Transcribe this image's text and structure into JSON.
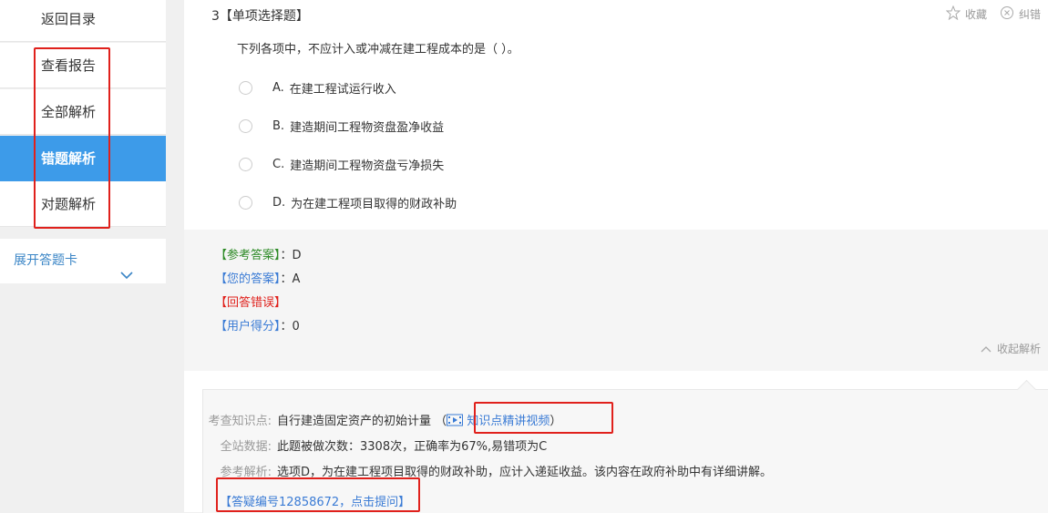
{
  "sidebar": {
    "items": [
      {
        "label": "返回目录"
      },
      {
        "label": "查看报告"
      },
      {
        "label": "全部解析"
      },
      {
        "label": "错题解析"
      },
      {
        "label": "对题解析"
      }
    ],
    "expand_label": "展开答题卡",
    "active_color": "#3d9be9"
  },
  "question": {
    "title": "3【单项选择题】",
    "favorite_label": "收藏",
    "report_label": "纠错",
    "text": "下列各项中，不应计入或冲减在建工程成本的是（    ）。",
    "options": [
      {
        "letter": "A.",
        "text": "在建工程试运行收入"
      },
      {
        "letter": "B.",
        "text": "建造期间工程物资盘盈净收益"
      },
      {
        "letter": "C.",
        "text": "建造期间工程物资盘亏净损失"
      },
      {
        "letter": "D.",
        "text": "为在建工程项目取得的财政补助"
      }
    ]
  },
  "answer": {
    "ref_label": "【参考答案】",
    "ref_value": "D",
    "your_label": "【您的答案】",
    "your_value": "A",
    "result_label": "【回答错误】",
    "score_label": "【用户得分】",
    "score_value": "0",
    "sep": "：",
    "collapse_label": "收起解析"
  },
  "analysis": {
    "knowledge_label": "考查知识点:",
    "knowledge_value": "自行建造固定资产的初始计量",
    "video_link": "知识点精讲视频",
    "stats_label": "全站数据:",
    "stats_value": "此题被做次数：3308次，正确率为67%,易错项为C",
    "ref_label": "参考解析:",
    "ref_value": "选项D，为在建工程项目取得的财政补助，应计入递延收益。该内容在政府补助中有详细讲解。",
    "qa_link": "【答疑编号12858672，点击提问】"
  }
}
